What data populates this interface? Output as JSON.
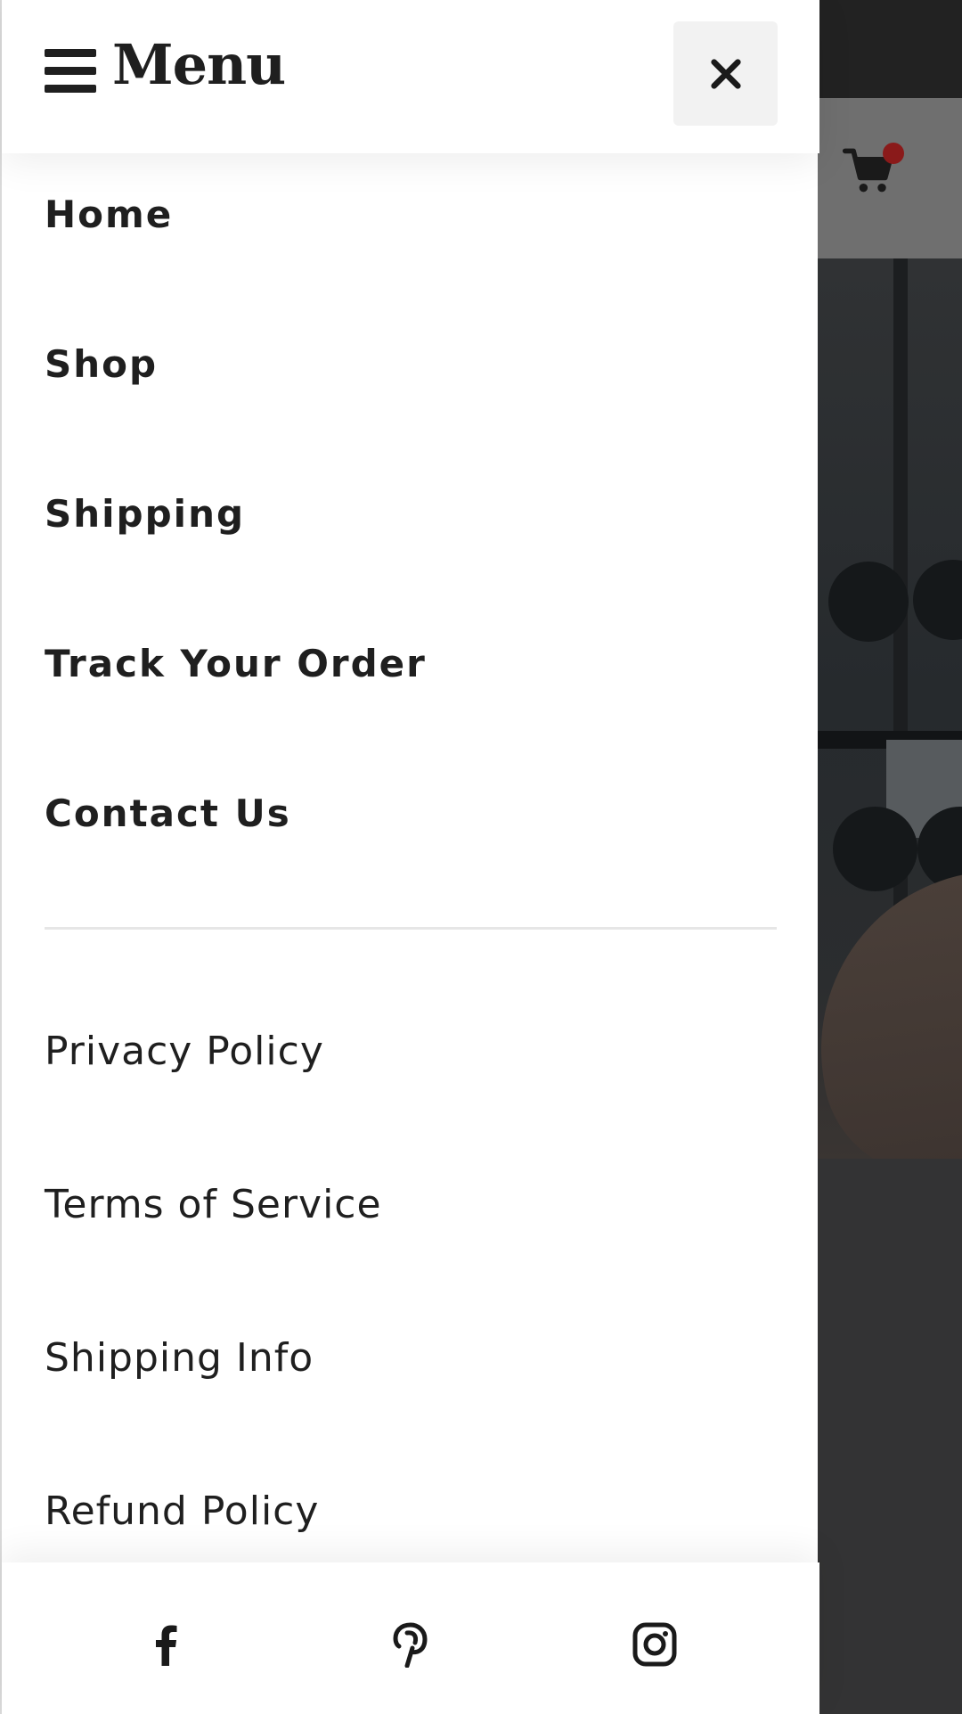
{
  "header": {
    "menu_title": "Menu",
    "menu_icon": "hamburger-icon",
    "close_icon": "close-icon"
  },
  "nav": {
    "items": [
      {
        "label": "Home"
      },
      {
        "label": "Shop"
      },
      {
        "label": "Shipping"
      },
      {
        "label": "Track Your Order"
      },
      {
        "label": "Contact Us"
      }
    ]
  },
  "secondary": {
    "items": [
      {
        "label": "Privacy Policy"
      },
      {
        "label": "Terms of Service"
      },
      {
        "label": "Shipping Info"
      },
      {
        "label": "Refund Policy"
      }
    ]
  },
  "social": {
    "icons": [
      "facebook-icon",
      "pinterest-icon",
      "instagram-icon"
    ]
  },
  "background_page": {
    "cart_icon": "cart-icon",
    "cart_badge_color": "#8a1a1a"
  },
  "colors": {
    "text": "#1f1f1f",
    "drawer_bg": "#ffffff",
    "close_bg": "#f2f2f2"
  }
}
